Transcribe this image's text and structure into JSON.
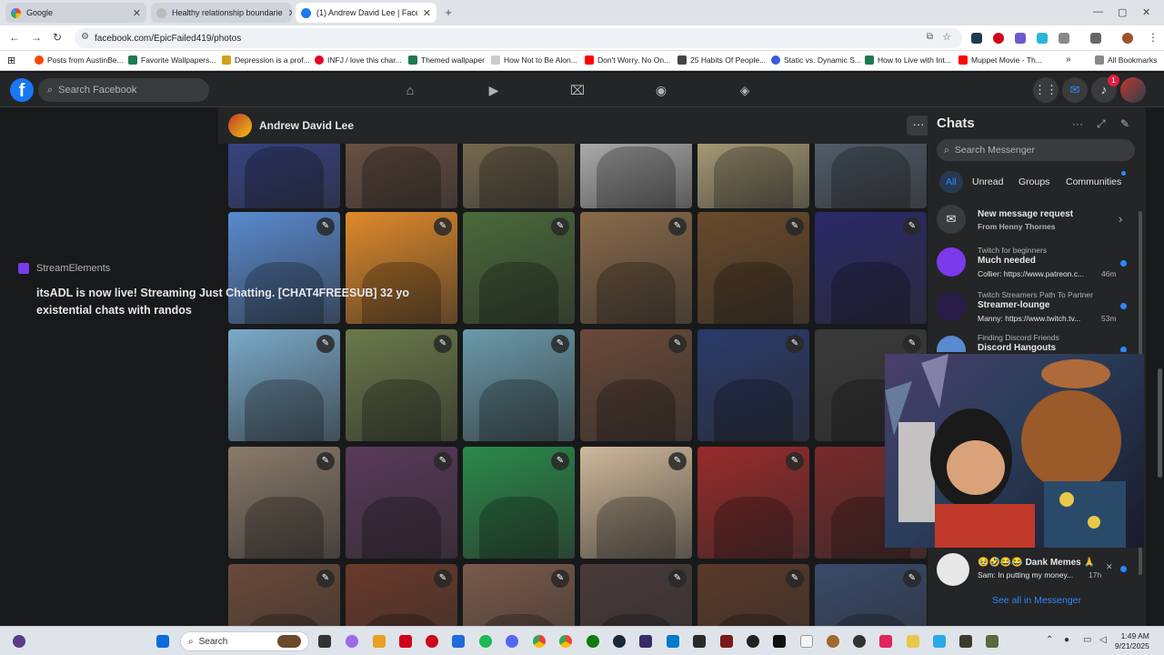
{
  "browser": {
    "tabs": [
      {
        "title": "Google",
        "active": false
      },
      {
        "title": "Healthy relationship boundarie",
        "active": false
      },
      {
        "title": "(1) Andrew David Lee | Faceboo",
        "active": true
      }
    ],
    "url": "facebook.com/EpicFailed419/photos",
    "bookmarks": [
      "Posts from AustinBe...",
      "Favorite Wallpapers...",
      "Depression is a prof...",
      "INFJ / love this char...",
      "Themed wallpaper",
      "How Not to Be Alon...",
      "Don't Worry, No On...",
      "25 Habits Of People...",
      "Static vs. Dynamic S...",
      "How to Live with Int...",
      "Muppet Movie - Th..."
    ],
    "all_bookmarks": "All Bookmarks"
  },
  "facebook": {
    "logo": "f",
    "search_placeholder": "Search Facebook",
    "notification_count": "1",
    "profile_name": "Andrew David Lee",
    "more": "···"
  },
  "stream": {
    "source": "StreamElements",
    "message": "itsADL is now live! Streaming Just Chatting. [CHAT4FREESUB] 32 yo existential chats with randos"
  },
  "photos": {
    "edit_icon": "✎",
    "rows": [
      [
        "#3a4a9a",
        "#7a5a4a",
        "#8a7a5a",
        "#cfcfcf",
        "#c8b88a",
        "#5a6a7a"
      ],
      [
        "#5a8acf",
        "#e08a2a",
        "#4a6a3a",
        "#8a6a4a",
        "#6a4a2a",
        "#2a2a6a"
      ],
      [
        "#7aaaca",
        "#6a7a4a",
        "#6a9aaa",
        "#6a4a3a",
        "#2a3a6a",
        "#3a3a3a"
      ],
      [
        "#8a7a6a",
        "#5a3a5a",
        "#2a8a4a",
        "#cfb89a",
        "#9a2a2a",
        "#7a2a2a"
      ],
      [
        "#6a4a3a",
        "#6a3a2a",
        "#7a5a4a",
        "#4a3a3a",
        "#5a3a2a",
        "#3a4a6a"
      ]
    ]
  },
  "chats": {
    "title": "Chats",
    "search_placeholder": "Search Messenger",
    "filters": [
      "All",
      "Unread",
      "Groups",
      "Communities"
    ],
    "items": [
      {
        "meta": "",
        "title": "New message request",
        "snippet": "From Henny Thornes"
      },
      {
        "meta": "Twitch for beginners",
        "title": "Much needed",
        "snippet": "Collier: https://www.patreon.c...",
        "time": "46m"
      },
      {
        "meta": "Twitch Streamers Path To Partner",
        "title": "Streamer-lounge",
        "snippet": "Manny: https://www.twitch.tv...",
        "time": "53m"
      },
      {
        "meta": "Finding Discord Friends",
        "title": "Discord Hangouts",
        "snippet": ""
      },
      {
        "meta": "",
        "title": "🥹🤣😂😂 Dank Memes 🙏",
        "snippet": "Sam: In putting my money...",
        "time": "17h"
      }
    ],
    "see_all": "See all in Messenger"
  },
  "taskbar": {
    "search_label": "Search",
    "time": "1:49 AM",
    "date": "9/21/2025"
  }
}
